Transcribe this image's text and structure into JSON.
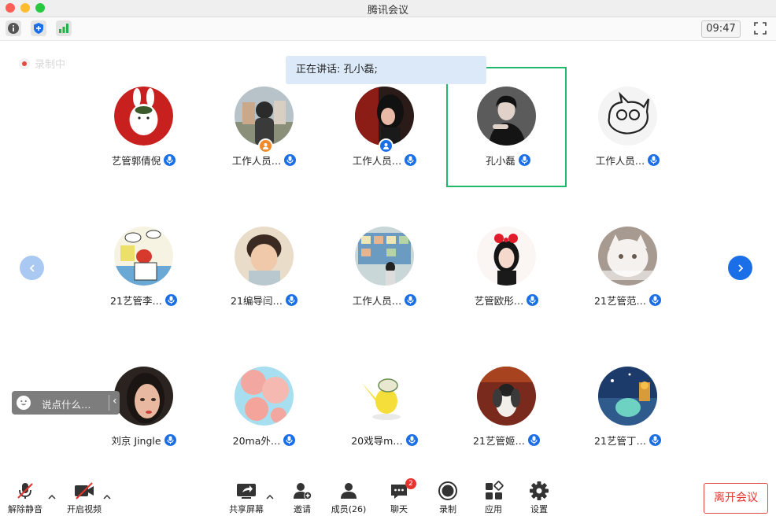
{
  "window": {
    "title": "腾讯会议"
  },
  "toolbar": {
    "clock": "09:47"
  },
  "recording": {
    "label": "录制中"
  },
  "speaking": {
    "label": "正在讲话: 孔小磊;"
  },
  "participants": [
    {
      "name": "艺管郭倩倪",
      "role_icon": "none",
      "active": false
    },
    {
      "name": "工作人员…",
      "role_icon": "host-icon",
      "active": false
    },
    {
      "name": "工作人员…",
      "role_icon": "cohost-icon",
      "active": false
    },
    {
      "name": "孔小磊",
      "role_icon": "none",
      "active": true
    },
    {
      "name": "工作人员…",
      "role_icon": "none",
      "active": false
    },
    {
      "name": "21艺管李…",
      "role_icon": "none",
      "active": false
    },
    {
      "name": "21编导闫…",
      "role_icon": "none",
      "active": false
    },
    {
      "name": "工作人员…",
      "role_icon": "none",
      "active": false
    },
    {
      "name": "艺管欧彤…",
      "role_icon": "none",
      "active": false
    },
    {
      "name": "21艺管范…",
      "role_icon": "none",
      "active": false
    },
    {
      "name": "刘京 Jingle",
      "role_icon": "none",
      "active": false
    },
    {
      "name": "20ma外…",
      "role_icon": "none",
      "active": false
    },
    {
      "name": "20戏导m…",
      "role_icon": "none",
      "active": false
    },
    {
      "name": "21艺管姬…",
      "role_icon": "none",
      "active": false
    },
    {
      "name": "21艺管丁…",
      "role_icon": "none",
      "active": false
    }
  ],
  "chat": {
    "placeholder": "说点什么…"
  },
  "controls": {
    "unmute": "解除静音",
    "start_video": "开启视频",
    "share_screen": "共享屏幕",
    "invite": "邀请",
    "members": "成员(26)",
    "chat": "聊天",
    "chat_badge": "2",
    "record": "录制",
    "apps": "应用",
    "settings": "设置",
    "leave": "离开会议"
  },
  "colors": {
    "accent": "#1a6ee8",
    "active_border": "#1fb86d",
    "leave": "#e5352d",
    "host": "#f08a2a"
  }
}
